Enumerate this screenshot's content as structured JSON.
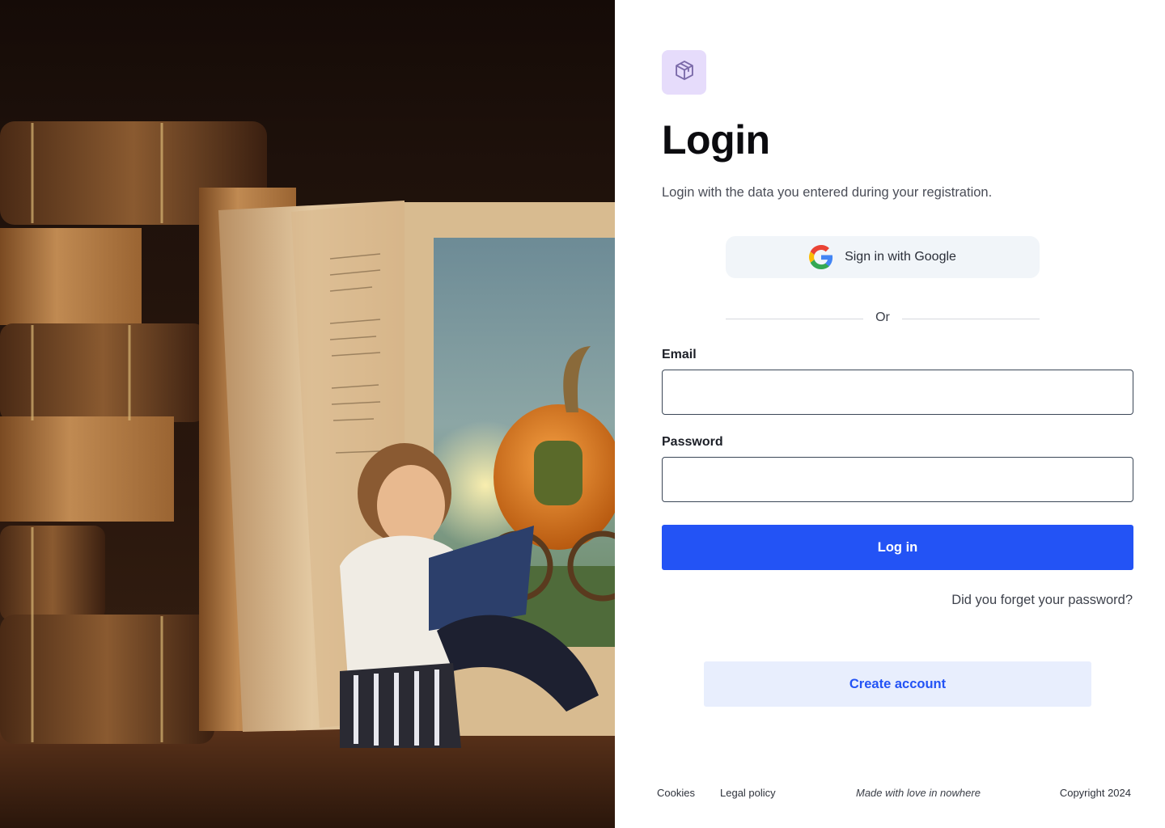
{
  "hero": {
    "image": "illustration of a child reading beside a giant open book with a pumpkin carriage"
  },
  "brand": {
    "logo_icon": "cube-icon",
    "logo_bg": "#e6dcfb",
    "logo_fg": "#7b6aa9"
  },
  "login": {
    "title": "Login",
    "subtitle": "Login with the data you entered during your registration.",
    "google_label": "Sign in with Google",
    "divider_text": "Or",
    "email_label": "Email",
    "email_value": "",
    "email_placeholder": "",
    "password_label": "Password",
    "password_value": "",
    "password_placeholder": "",
    "submit_label": "Log in",
    "forgot_label": "Did you forget your password?",
    "create_label": "Create account"
  },
  "footer": {
    "cookies": "Cookies",
    "legal": "Legal policy",
    "made_with": "Made with love in nowhere",
    "copyright": "Copyright 2024"
  },
  "colors": {
    "primary": "#2353f5",
    "secondary_bg": "#e8eefd",
    "google_btn_bg": "#f1f5f9",
    "input_border": "#3b4757"
  }
}
